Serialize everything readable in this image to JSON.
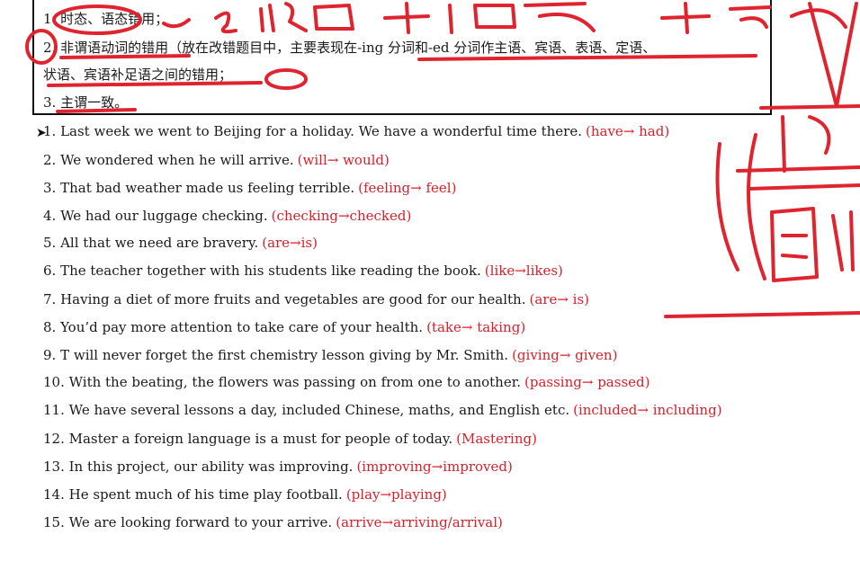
{
  "header_box": {
    "lines": [
      "1. 时态、语态错用；",
      "2. 非谓语动词的错用（放在改错题目中，主要表现在-ing 分词和-ed 分词作主语、宾语、表语、定语、",
      "状语、宾语补足语之间的错用；",
      "3. 主谓一致。"
    ]
  },
  "items": [
    {
      "q": "1. Last week we went to Beijing for a holiday. We have a wonderful time there.",
      "a": "(have→ had)"
    },
    {
      "q": "2. We wondered when he will arrive.",
      "a": "(will→ would)"
    },
    {
      "q": "3. That bad weather made us feeling terrible.",
      "a": "(feeling→ feel)"
    },
    {
      "q": "4. We had our luggage checking.",
      "a": "(checking→checked)"
    },
    {
      "q": "5. All that we need are bravery.",
      "a": "(are→is)"
    },
    {
      "q": "6. The teacher together with his students like reading the book.",
      "a": "(like→likes)"
    },
    {
      "q": "7. Having a diet of more fruits and vegetables are good for our health.",
      "a": "(are→ is)"
    },
    {
      "q": "8. You’d pay more attention to take care of your health.",
      "a": "(take→ taking)"
    },
    {
      "q": "9. T will never forget the first chemistry lesson giving by Mr. Smith.",
      "a": "(giving→ given)"
    },
    {
      "q": "10. With the beating, the flowers was passing on from one to another.",
      "a": "(passing→ passed)"
    },
    {
      "q": "11. We have several lessons a day, included Chinese, maths, and English etc.",
      "a": "(included→ including)"
    },
    {
      "q": "12. Master a foreign language is a must for people of today.",
      "a": "(Mastering)"
    },
    {
      "q": "13. In this project, our ability was improving.",
      "a": "(improving→improved)"
    },
    {
      "q": "14. He spent much of his time play football.",
      "a": "(play→playing)"
    },
    {
      "q": "15. We are looking forward to your arrive.",
      "a": "(arrive→arriving/arrival)"
    }
  ],
  "colors": {
    "answer": "#d8202a",
    "ink": "#e0242f"
  }
}
